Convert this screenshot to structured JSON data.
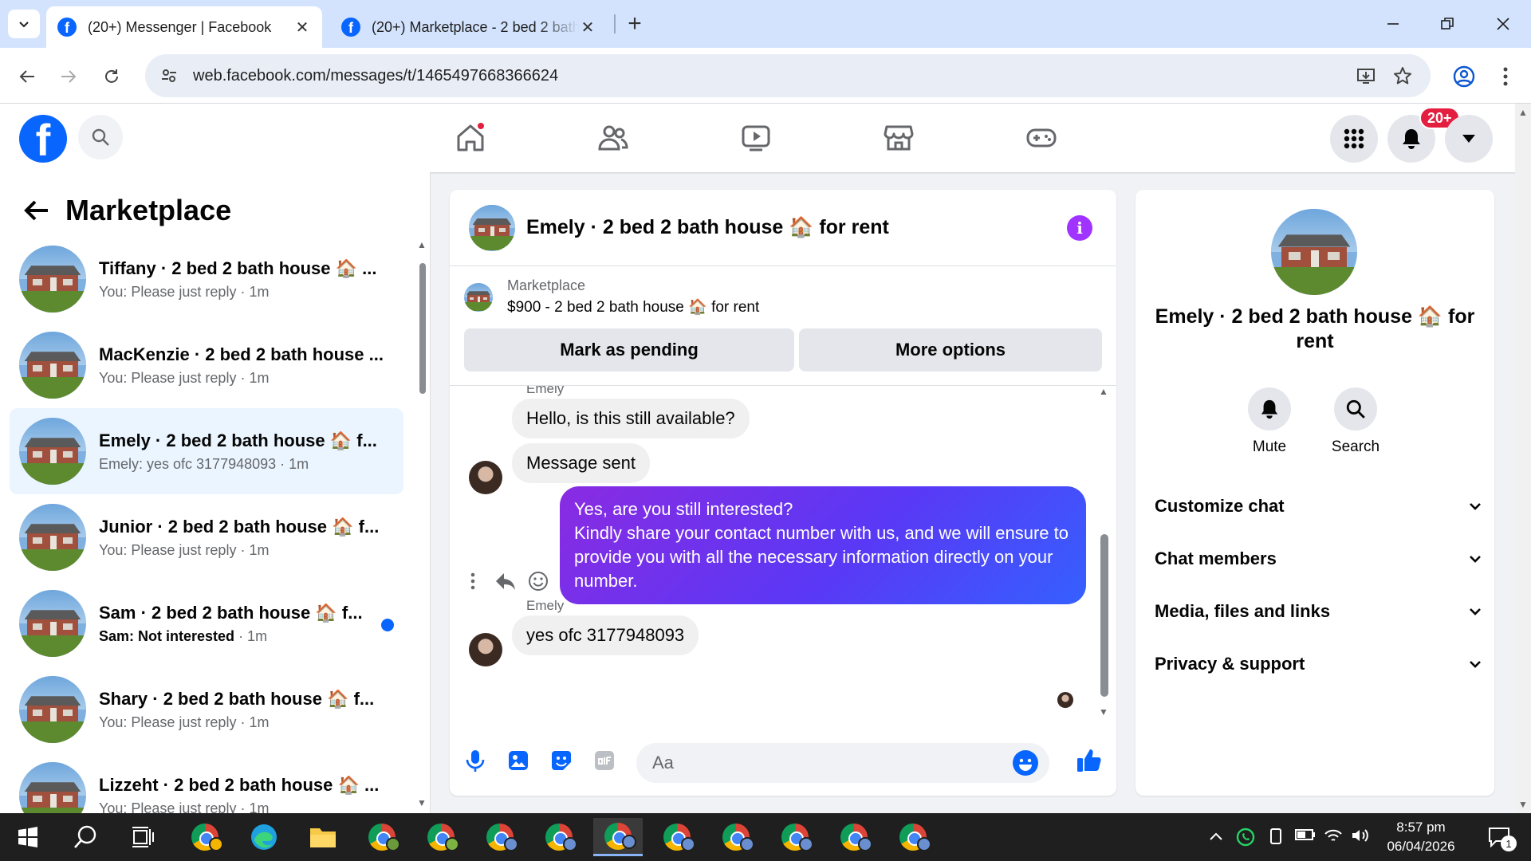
{
  "browser": {
    "tabs": [
      {
        "title": "(20+) Messenger | Facebook",
        "active": true
      },
      {
        "title": "(20+) Marketplace - 2 bed 2 bath",
        "active": false
      }
    ],
    "url": "web.facebook.com/messages/t/1465497668366624"
  },
  "header": {
    "notification_badge": "20+"
  },
  "sidebar": {
    "title": "Marketplace",
    "conversations": [
      {
        "name": "Tiffany · 2 bed 2 bath house 🏠 ...",
        "preview": "You: Please just reply",
        "time": "· 1m",
        "selected": false,
        "unread": false
      },
      {
        "name": "MacKenzie · 2 bed 2 bath house ...",
        "preview": "You: Please just reply",
        "time": "· 1m",
        "selected": false,
        "unread": false
      },
      {
        "name": "Emely · 2 bed 2 bath house 🏠 f...",
        "preview": "Emely: yes ofc 3177948093",
        "time": "· 1m",
        "selected": true,
        "unread": false
      },
      {
        "name": "Junior · 2 bed 2 bath house 🏠 f...",
        "preview": "You: Please just reply",
        "time": "· 1m",
        "selected": false,
        "unread": false
      },
      {
        "name": "Sam · 2 bed 2 bath house 🏠 f...",
        "preview": "Sam: Not interested",
        "time": "· 1m",
        "selected": false,
        "unread": true
      },
      {
        "name": "Shary · 2 bed 2 bath house 🏠 f...",
        "preview": "You: Please just reply",
        "time": "· 1m",
        "selected": false,
        "unread": false
      },
      {
        "name": "Lizzeht · 2 bed 2 bath house 🏠 ...",
        "preview": "You: Please just reply",
        "time": "· 1m",
        "selected": false,
        "unread": false
      }
    ]
  },
  "chat": {
    "title": "Emely · 2 bed 2 bath house 🏠 for rent",
    "listing": {
      "label": "Marketplace",
      "price_line": "$900 - 2 bed 2 bath house 🏠 for rent",
      "mark_pending": "Mark as pending",
      "more_options": "More options"
    },
    "messages": {
      "sender_top": "Emely",
      "msg1": "Hello, is this still available?",
      "msg2": "Message sent",
      "out_lines": [
        "Yes, are you still interested?",
        "Kindly share your contact number with us, and we will ensure to provide you with all the necessary information directly on your number."
      ],
      "sender_bottom": "Emely",
      "msg3": "yes ofc 3177948093"
    },
    "composer_placeholder": "Aa"
  },
  "info_panel": {
    "name": "Emely · 2 bed 2 bath house 🏠 for rent",
    "mute_label": "Mute",
    "search_label": "Search",
    "sections": [
      "Customize chat",
      "Chat members",
      "Media, files and links",
      "Privacy & support"
    ]
  },
  "taskbar": {
    "time": "8:57 pm",
    "date": "06/04/2026",
    "notification_count": "1"
  },
  "colors": {
    "facebook_blue": "#0866ff",
    "outgoing_bubble_start": "#8a2be2",
    "outgoing_bubble_end": "#3560ff",
    "unread_dot": "#0866ff",
    "badge_red": "#e41e3f"
  }
}
